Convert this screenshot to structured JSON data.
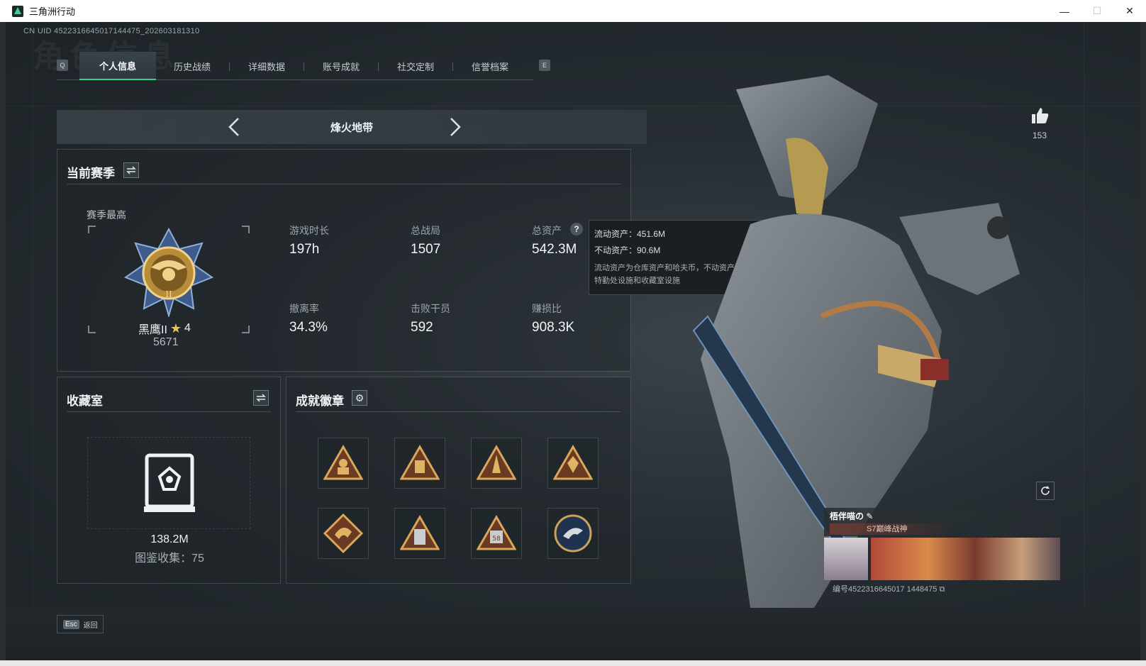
{
  "window": {
    "title": "三角洲行动",
    "controls": [
      "—",
      "☐",
      "✕"
    ]
  },
  "header": {
    "uid": "CN UID 4522316645017144475_202603181310",
    "bg_title": "角色信息"
  },
  "tabs": {
    "left_key": "Q",
    "right_key": "E",
    "items": [
      "个人信息",
      "历史战绩",
      "详细数据",
      "账号成就",
      "社交定制",
      "信誉档案"
    ],
    "active": 0
  },
  "mode": {
    "label": "烽火地带"
  },
  "season": {
    "title": "当前赛季",
    "best_label": "赛季最高",
    "rank_name": "黑鹰II",
    "rank_stars": "4",
    "rank_score": "5671",
    "stats": [
      {
        "label": "游戏时长",
        "value": "197h"
      },
      {
        "label": "总战局",
        "value": "1507"
      },
      {
        "label": "总资产",
        "value": "542.3M"
      },
      {
        "label": "撤离率",
        "value": "34.3%"
      },
      {
        "label": "击败干员",
        "value": "592"
      },
      {
        "label": "赚损比",
        "value": "908.3K"
      }
    ]
  },
  "tooltip": {
    "liquid": "流动资产：451.6M",
    "fixed": "不动资产：90.6M",
    "note_line1": "流动资产为仓库资产和哈夫币，不动资产为",
    "note_line2": "特勤处设施和收藏室设施"
  },
  "collection": {
    "title": "收藏室",
    "value": "138.2M",
    "progress": "图鉴收集：75"
  },
  "achievements": {
    "title": "成就徽章",
    "badges": [
      "triangle-soldier-badge",
      "triangle-fort-badge",
      "triangle-tower-badge",
      "triangle-emblem-badge",
      "dragon-diamond-badge",
      "triangle-device-badge",
      "triangle-58-badge",
      "eagle-round-badge"
    ]
  },
  "likes": {
    "count": "153"
  },
  "player_card": {
    "name": "梧伴喵の",
    "tagline": "S7巅峰战神",
    "id_line": "编号4522316645017 1448475"
  },
  "footer": {
    "esc_key": "Esc",
    "esc_label": "返回"
  },
  "colors": {
    "accent": "#33d38b",
    "bg": "#262d32"
  }
}
